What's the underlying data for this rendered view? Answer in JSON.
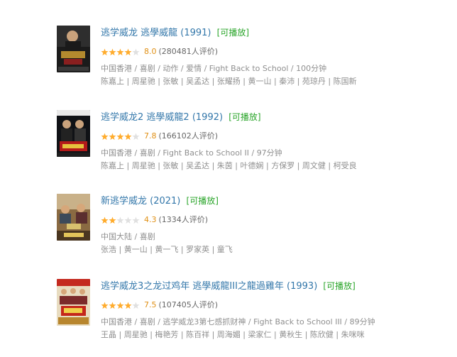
{
  "results": [
    {
      "title": "逃学威龙 逃學威龍",
      "year": "(1991)",
      "playable": "[可播放]",
      "rating": 8.0,
      "score": "8.0",
      "count": "(280481人评价)",
      "meta": "中国香港 / 喜剧 / 动作 / 爱情 / Fight Back to School / 100分钟",
      "cast": "陈嘉上 | 周星驰 | 张敏 | 吴孟达 | 张耀扬 | 黄一山 | 秦沛 | 苑琼丹 | 陈国新"
    },
    {
      "title": "逃学威龙2 逃學威龍2",
      "year": "(1992)",
      "playable": "[可播放]",
      "rating": 7.8,
      "score": "7.8",
      "count": "(166102人评价)",
      "meta": "中国香港 / 喜剧 / Fight Back to School II / 97分钟",
      "cast": "陈嘉上 | 周星驰 | 张敏 | 吴孟达 | 朱茵 | 叶德娴 | 方保罗 | 周文健 | 柯受良"
    },
    {
      "title": "新逃学威龙",
      "year": "(2021)",
      "playable": "[可播放]",
      "rating": 4.3,
      "score": "4.3",
      "count": "(1334人评价)",
      "meta": "中国大陆 / 喜剧",
      "cast": "张浩 | 黄一山 | 黄一飞 | 罗家英 | 童飞"
    },
    {
      "title": "逃学威龙3之龙过鸡年 逃學威龍III之龍過雞年",
      "year": "(1993)",
      "playable": "[可播放]",
      "rating": 7.5,
      "score": "7.5",
      "count": "(107405人评价)",
      "meta": "中国香港 / 喜剧 / 逃学威龙3第七感抓财神 / Fight Back to School III / 89分钟",
      "cast": "王晶 | 周星驰 | 梅艳芳 | 陈百祥 | 周海媚 | 梁家仁 | 黄秋生 | 陈欣健 | 朱咪咪"
    }
  ],
  "colors": {
    "link": "#3377aa",
    "playable": "#2aa52a",
    "star": "#ffac2d",
    "star_empty": "#e0e0e0",
    "score": "#e09015",
    "meta": "#8f8f8f"
  }
}
